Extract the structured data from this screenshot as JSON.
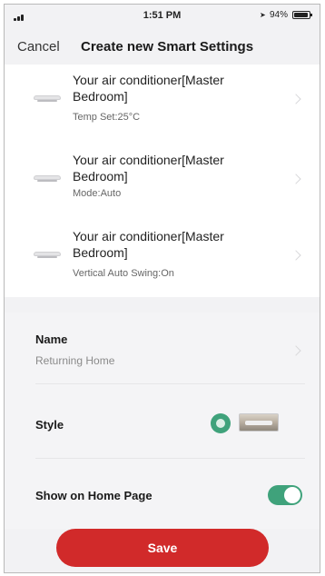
{
  "status_bar": {
    "time": "1:51 PM",
    "battery_text": "94%",
    "battery_level": 0.94
  },
  "nav": {
    "cancel_label": "Cancel",
    "title": "Create new Smart Settings"
  },
  "actions": [
    {
      "title": "Your air conditioner[Master Bedroom]",
      "detail": "Temp Set:25°C",
      "icon": "air-conditioner-icon"
    },
    {
      "title": "Your air conditioner[Master Bedroom]",
      "detail": "Mode:Auto",
      "icon": "air-conditioner-icon"
    },
    {
      "title": "Your air conditioner[Master Bedroom]",
      "detail": "Vertical Auto Swing:On",
      "icon": "air-conditioner-icon"
    }
  ],
  "settings": {
    "name_label": "Name",
    "name_value": "Returning Home",
    "style_label": "Style",
    "style_icon": "green-circle-icon",
    "style_thumbnail": "scene-thumbnail",
    "show_home_label": "Show on Home Page",
    "show_home_enabled": true,
    "accent_color": "#3fa27b"
  },
  "save_label": "Save",
  "save_color": "#d12a2a"
}
